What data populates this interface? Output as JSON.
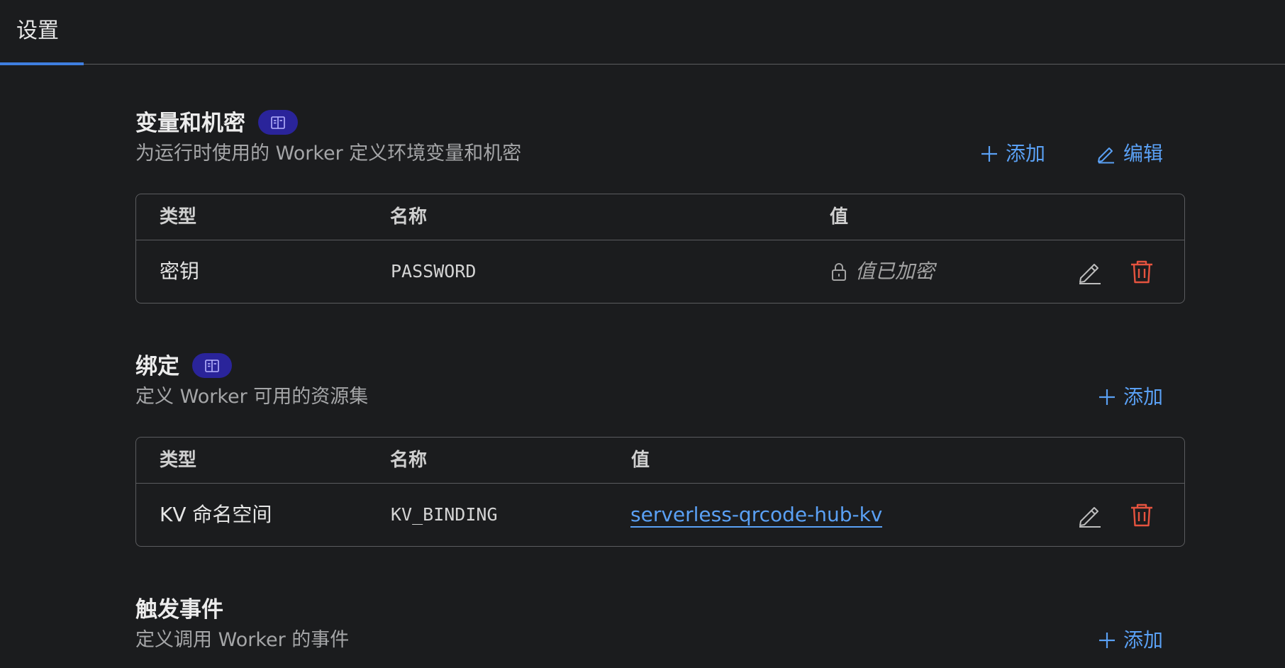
{
  "tabs": {
    "active_label": "设置"
  },
  "variables": {
    "title": "变量和机密",
    "badge_icon": "book-icon",
    "description": "为运行时使用的 Worker 定义环境变量和机密",
    "add_label": "添加",
    "edit_label": "编辑",
    "columns": {
      "type": "类型",
      "name": "名称",
      "value": "值"
    },
    "rows": [
      {
        "type": "密钥",
        "name": "PASSWORD",
        "value": "值已加密"
      }
    ]
  },
  "bindings": {
    "title": "绑定",
    "badge_icon": "book-icon",
    "description": "定义 Worker 可用的资源集",
    "add_label": "添加",
    "columns": {
      "type": "类型",
      "name": "名称",
      "value": "值"
    },
    "rows": [
      {
        "type": "KV 命名空间",
        "name": "KV_BINDING",
        "value": "serverless-qrcode-hub-kv"
      }
    ]
  },
  "triggers": {
    "title": "触发事件",
    "description": "定义调用 Worker 的事件",
    "add_label": "添加"
  },
  "colors": {
    "accent": "#5aa0f4",
    "danger": "#e5533f",
    "badge": "#2a249a",
    "tab_underline": "#3f7ee0"
  }
}
